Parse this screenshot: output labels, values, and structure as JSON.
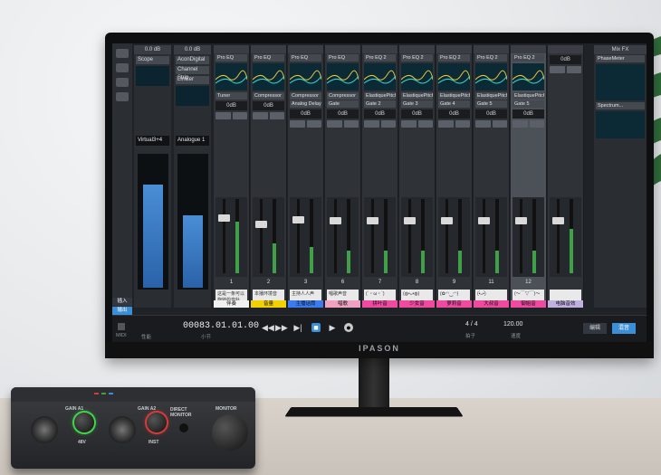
{
  "scene": {
    "colors": {
      "wall": "#e6e8ea",
      "accent": "#3b8fd6",
      "green_ring": "#41d646",
      "red_ring": "#d63b3b"
    }
  },
  "monitor": {
    "brand": "IPASON"
  },
  "daw": {
    "presets": [
      {
        "level": "0.0 dB",
        "plugins": [
          "Scope"
        ],
        "channel": "Virtual3+4",
        "meter": 0.78
      },
      {
        "level": "0.0 dB",
        "plugins": [
          "AconDigital",
          "Channel Strip",
          "Limiter"
        ],
        "channel": "Analogue 1",
        "meter": 0.55
      }
    ],
    "side_tabs": [
      "插入",
      "输出"
    ],
    "strips": [
      {
        "num": "1",
        "plugins": [
          "Pro EQ",
          "Tuner"
        ],
        "vol": "0dB",
        "label": "伴奏",
        "label_color": "#f0f0f0",
        "note": "这是一条可以旋转的音轨",
        "meter": 0.7,
        "fader": 0.25,
        "sel": false
      },
      {
        "num": "2",
        "plugins": [
          "Pro EQ",
          "Compressor"
        ],
        "vol": "0dB",
        "label": "音量",
        "label_color": "#f0d000",
        "note": "本播环境音",
        "meter": 0.4,
        "fader": 0.35,
        "sel": false
      },
      {
        "num": "3",
        "plugins": [
          "Pro EQ",
          "Compressor",
          "Analog Delay"
        ],
        "vol": "0dB",
        "label": "主播话筒",
        "label_color": "#3b7bf0",
        "note": "主持人人声",
        "meter": 0.35,
        "fader": 0.28,
        "sel": false
      },
      {
        "num": "6",
        "plugins": [
          "Pro EQ",
          "Compressor",
          "Gate"
        ],
        "vol": "0dB",
        "label": "唱歌",
        "label_color": "#f0a0c0",
        "note": "唱歌声音",
        "meter": 0.3,
        "fader": 0.3,
        "sel": false
      },
      {
        "num": "7",
        "plugins": [
          "Pro EQ 2",
          "ElastiquePitch",
          "Gate 2"
        ],
        "vol": "0dB",
        "label": "拼叶音",
        "label_color": "#f04aa0",
        "note": "(´・ω・`)",
        "meter": 0.3,
        "fader": 0.3,
        "sel": false
      },
      {
        "num": "8",
        "plugins": [
          "Pro EQ 2",
          "ElastiquePitch",
          "Gate 3"
        ],
        "vol": "0dB",
        "label": "少女音",
        "label_color": "#f04aa0",
        "note": "(◍•ᴗ•◍)",
        "meter": 0.3,
        "fader": 0.3,
        "sel": false
      },
      {
        "num": "9",
        "plugins": [
          "Pro EQ 2",
          "ElastiquePitch",
          "Gate 4"
        ],
        "vol": "0dB",
        "label": "萝莉音",
        "label_color": "#f04aa0",
        "note": "(✿◠‿◠)",
        "meter": 0.3,
        "fader": 0.3,
        "sel": false
      },
      {
        "num": "11",
        "plugins": [
          "Pro EQ 2",
          "ElastiquePitch",
          "Gate 5"
        ],
        "vol": "0dB",
        "label": "大叔音",
        "label_color": "#f04aa0",
        "note": "(•̀ᴗ•́)",
        "meter": 0.3,
        "fader": 0.3,
        "sel": false
      },
      {
        "num": "12",
        "plugins": [
          "Pro EQ 2",
          "ElastiquePitch",
          "Gate 5"
        ],
        "vol": "0dB",
        "label": "御姐音",
        "label_color": "#f04aa0",
        "note": "(～￣▽￣)～",
        "meter": 0.3,
        "fader": 0.3,
        "sel": true
      },
      {
        "num": "",
        "plugins": [],
        "vol": "0dB",
        "label": "电脑音效",
        "label_color": "#c0b0e0",
        "note": "",
        "meter": 0.6,
        "fader": 0.3,
        "sel": false
      }
    ],
    "fx": {
      "title": "Mix FX",
      "plugins": [
        "PhaseMeter",
        "Spectrum..."
      ]
    },
    "transport": {
      "timecode": "00083.01.01.00",
      "timecode_unit": "小节",
      "midi_label": "MIDI",
      "perf_label": "性能",
      "signature": "4 / 4",
      "signature_label": "拍子",
      "tempo": "120.00",
      "tempo_label": "速度",
      "tabs": [
        "编辑",
        "混音"
      ]
    }
  },
  "interface": {
    "labels": {
      "ch1": "GAIN A1",
      "ch2": "GAIN A2",
      "monitor_label": "MONITOR",
      "direct": "DIRECT MONITOR",
      "v48": "48V",
      "inst": "INST"
    }
  }
}
